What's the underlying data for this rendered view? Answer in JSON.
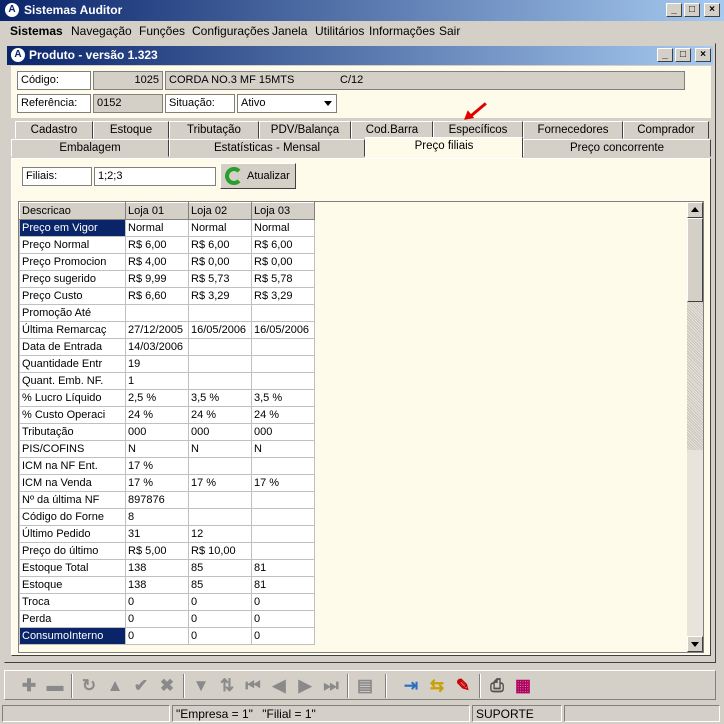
{
  "app": {
    "title": "Sistemas Auditor"
  },
  "menubar": [
    "Sistemas",
    "Navegação",
    "Funções",
    "Configurações",
    "Janela",
    "Utilitários",
    "Informações",
    "Sair"
  ],
  "window": {
    "title": "Produto - versão 1.323"
  },
  "form": {
    "codigo_label": "Código:",
    "codigo_value": "1025",
    "descricao_value": "CORDA NO.3 MF 15MTS",
    "unidade_value": "C/12",
    "referencia_label": "Referência:",
    "referencia_value": "0152",
    "situacao_label": "Situação:",
    "situacao_value": "Ativo"
  },
  "tabs_row1": [
    "Cadastro",
    "Estoque",
    "Tributação",
    "PDV/Balança",
    "Cod.Barra",
    "Específicos",
    "Fornecedores",
    "Comprador"
  ],
  "tabs_row2": [
    "Embalagem",
    "Estatísticas - Mensal",
    "Preço filiais",
    "Preço concorrente"
  ],
  "active_tab": "Preço filiais",
  "filiais": {
    "label": "Filiais:",
    "value": "1;2;3",
    "button": "Atualizar"
  },
  "grid": {
    "headers": [
      "Descricao",
      "Loja 01",
      "Loja 02",
      "Loja 03"
    ],
    "rows": [
      [
        "Preço em Vigor",
        "Normal",
        "Normal",
        "Normal"
      ],
      [
        "Preço Normal",
        "R$ 6,00",
        "R$ 6,00",
        "R$ 6,00"
      ],
      [
        "Preço Promocion",
        "R$ 4,00",
        "R$ 0,00",
        "R$ 0,00"
      ],
      [
        "Preço sugerido",
        "R$ 9,99",
        "R$ 5,73",
        "R$ 5,78"
      ],
      [
        "Preço Custo",
        "R$ 6,60",
        "R$ 3,29",
        "R$ 3,29"
      ],
      [
        "Promoção Até",
        "",
        "",
        ""
      ],
      [
        "Última Remarcaç",
        "27/12/2005",
        "16/05/2006",
        "16/05/2006"
      ],
      [
        "Data de Entrada",
        "14/03/2006",
        "",
        ""
      ],
      [
        "Quantidade Entr",
        "19",
        "",
        ""
      ],
      [
        "Quant. Emb. NF.",
        "1",
        "",
        ""
      ],
      [
        "% Lucro Líquido",
        "2,5 %",
        "3,5 %",
        "3,5 %"
      ],
      [
        "% Custo Operaci",
        "24 %",
        "24 %",
        "24 %"
      ],
      [
        "Tributação",
        "000",
        "000",
        "000"
      ],
      [
        "PIS/COFINS",
        "N",
        "N",
        "N"
      ],
      [
        "ICM na NF Ent.",
        "17 %",
        "",
        ""
      ],
      [
        "ICM na Venda",
        "17 %",
        "17 %",
        "17 %"
      ],
      [
        "Nº da última NF",
        "897876",
        "",
        ""
      ],
      [
        "Código do Forne",
        "8",
        "",
        ""
      ],
      [
        "Último Pedido",
        "31",
        "12",
        ""
      ],
      [
        "Preço do último",
        "R$ 5,00",
        "R$ 10,00",
        ""
      ],
      [
        "Estoque Total",
        "138",
        "85",
        "81"
      ],
      [
        "Estoque",
        "138",
        "85",
        "81"
      ],
      [
        "Troca",
        "0",
        "0",
        "0"
      ],
      [
        "Perda",
        "0",
        "0",
        "0"
      ],
      [
        "ConsumoInterno",
        "0",
        "0",
        "0"
      ]
    ],
    "selected_rows": [
      0,
      24
    ]
  },
  "statusbar": {
    "empresa": "\"Empresa = 1\"",
    "filial": "\"Filial = 1\"",
    "user": "SUPORTE"
  },
  "colors": {
    "title_active": "#0a246a",
    "panel": "#fffbea",
    "face": "#d4d0c8"
  }
}
